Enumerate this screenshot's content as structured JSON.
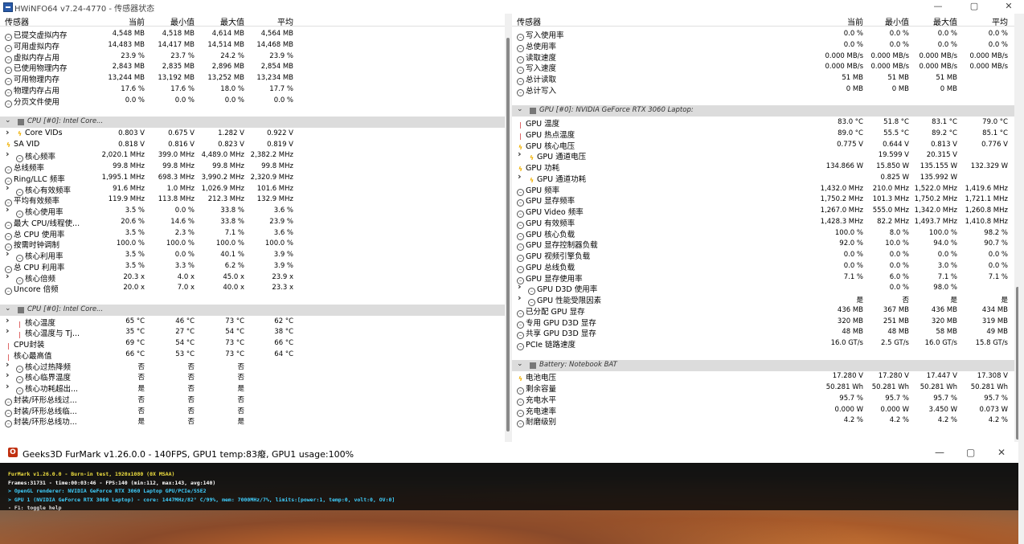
{
  "window": {
    "title": "HWiNFO64 v7.24-4770 - 传感器状态",
    "min": "—",
    "max": "▢",
    "close": "✕"
  },
  "left": {
    "headers": {
      "name": "传感器",
      "current": "当前",
      "min": "最小值",
      "max": "最大值",
      "avg": "平均"
    },
    "rows": [
      {
        "type": "item",
        "icon": "clock",
        "name": "已提交虚拟内存",
        "v": [
          "4,548 MB",
          "4,518 MB",
          "4,614 MB",
          "4,564 MB"
        ]
      },
      {
        "type": "item",
        "icon": "clock",
        "name": "可用虚拟内存",
        "v": [
          "14,483 MB",
          "14,417 MB",
          "14,514 MB",
          "14,468 MB"
        ]
      },
      {
        "type": "item",
        "icon": "clock",
        "name": "虚拟内存占用",
        "v": [
          "23.9 %",
          "23.7 %",
          "24.2 %",
          "23.9 %"
        ]
      },
      {
        "type": "item",
        "icon": "clock",
        "name": "已使用物理内存",
        "v": [
          "2,843 MB",
          "2,835 MB",
          "2,896 MB",
          "2,854 MB"
        ]
      },
      {
        "type": "item",
        "icon": "clock",
        "name": "可用物理内存",
        "v": [
          "13,244 MB",
          "13,192 MB",
          "13,252 MB",
          "13,234 MB"
        ]
      },
      {
        "type": "item",
        "icon": "clock",
        "name": "物理内存占用",
        "v": [
          "17.6 %",
          "17.6 %",
          "18.0 %",
          "17.7 %"
        ]
      },
      {
        "type": "item",
        "icon": "clock",
        "name": "分页文件使用",
        "v": [
          "0.0 %",
          "0.0 %",
          "0.0 %",
          "0.0 %"
        ]
      },
      {
        "type": "blank"
      },
      {
        "type": "group",
        "name": "CPU [#0]: Intel Core..."
      },
      {
        "type": "item",
        "expand": true,
        "icon": "bolt",
        "name": "Core VIDs",
        "v": [
          "0.803 V",
          "0.675 V",
          "1.282 V",
          "0.922 V"
        ]
      },
      {
        "type": "item",
        "icon": "bolt",
        "name": "SA VID",
        "v": [
          "0.818 V",
          "0.816 V",
          "0.823 V",
          "0.819 V"
        ]
      },
      {
        "type": "item",
        "expand": true,
        "icon": "clock",
        "name": "核心频率",
        "v": [
          "2,020.1 MHz",
          "399.0 MHz",
          "4,489.0 MHz",
          "2,382.2 MHz"
        ]
      },
      {
        "type": "item",
        "icon": "clock",
        "name": "总线频率",
        "v": [
          "99.8 MHz",
          "99.8 MHz",
          "99.8 MHz",
          "99.8 MHz"
        ]
      },
      {
        "type": "item",
        "icon": "clock",
        "name": "Ring/LLC 频率",
        "v": [
          "1,995.1 MHz",
          "698.3 MHz",
          "3,990.2 MHz",
          "2,320.9 MHz"
        ]
      },
      {
        "type": "item",
        "expand": true,
        "icon": "clock",
        "name": "核心有效频率",
        "v": [
          "91.6 MHz",
          "1.0 MHz",
          "1,026.9 MHz",
          "101.6 MHz"
        ]
      },
      {
        "type": "item",
        "icon": "clock",
        "name": "平均有效频率",
        "v": [
          "119.9 MHz",
          "113.8 MHz",
          "212.3 MHz",
          "132.9 MHz"
        ]
      },
      {
        "type": "item",
        "expand": true,
        "icon": "clock",
        "name": "核心使用率",
        "v": [
          "3.5 %",
          "0.0 %",
          "33.8 %",
          "3.6 %"
        ]
      },
      {
        "type": "item",
        "icon": "clock",
        "name": "最大 CPU/线程使...",
        "v": [
          "20.6 %",
          "14.6 %",
          "33.8 %",
          "23.9 %"
        ]
      },
      {
        "type": "item",
        "icon": "clock",
        "name": "总 CPU 使用率",
        "v": [
          "3.5 %",
          "2.3 %",
          "7.1 %",
          "3.6 %"
        ]
      },
      {
        "type": "item",
        "icon": "clock",
        "name": "按需时钟调制",
        "v": [
          "100.0 %",
          "100.0 %",
          "100.0 %",
          "100.0 %"
        ]
      },
      {
        "type": "item",
        "expand": true,
        "icon": "clock",
        "name": "核心利用率",
        "v": [
          "3.5 %",
          "0.0 %",
          "40.1 %",
          "3.9 %"
        ]
      },
      {
        "type": "item",
        "icon": "clock",
        "name": "总 CPU 利用率",
        "v": [
          "3.5 %",
          "3.3 %",
          "6.2 %",
          "3.9 %"
        ]
      },
      {
        "type": "item",
        "expand": true,
        "icon": "clock",
        "name": "核心倍频",
        "v": [
          "20.3 x",
          "4.0 x",
          "45.0 x",
          "23.9 x"
        ]
      },
      {
        "type": "item",
        "icon": "clock",
        "name": "Uncore 倍频",
        "v": [
          "20.0 x",
          "7.0 x",
          "40.0 x",
          "23.3 x"
        ]
      },
      {
        "type": "blank"
      },
      {
        "type": "group",
        "name": "CPU [#0]: Intel Core..."
      },
      {
        "type": "item",
        "expand": true,
        "icon": "therm",
        "name": "核心温度",
        "v": [
          "65 °C",
          "46 °C",
          "73 °C",
          "62 °C"
        ]
      },
      {
        "type": "item",
        "expand": true,
        "icon": "therm",
        "name": "核心温度与 Tj...",
        "v": [
          "35 °C",
          "27 °C",
          "54 °C",
          "38 °C"
        ]
      },
      {
        "type": "item",
        "icon": "therm",
        "name": "CPU封装",
        "v": [
          "69 °C",
          "54 °C",
          "73 °C",
          "66 °C"
        ]
      },
      {
        "type": "item",
        "icon": "therm",
        "name": "核心最高值",
        "v": [
          "66 °C",
          "53 °C",
          "73 °C",
          "64 °C"
        ]
      },
      {
        "type": "item",
        "expand": true,
        "icon": "clock",
        "name": "核心过热降频",
        "v": [
          "否",
          "否",
          "否",
          ""
        ]
      },
      {
        "type": "item",
        "expand": true,
        "icon": "clock",
        "name": "核心临界温度",
        "v": [
          "否",
          "否",
          "否",
          ""
        ]
      },
      {
        "type": "item",
        "expand": true,
        "icon": "clock",
        "name": "核心功耗超出...",
        "v": [
          "是",
          "否",
          "是",
          ""
        ]
      },
      {
        "type": "item",
        "icon": "clock",
        "name": "封装/环形总线过...",
        "v": [
          "否",
          "否",
          "否",
          ""
        ]
      },
      {
        "type": "item",
        "icon": "clock",
        "name": "封装/环形总线临...",
        "v": [
          "否",
          "否",
          "否",
          ""
        ]
      },
      {
        "type": "item",
        "icon": "clock",
        "name": "封装/环形总线功...",
        "v": [
          "是",
          "否",
          "是",
          ""
        ]
      }
    ]
  },
  "right": {
    "headers": {
      "name": "传感器",
      "current": "当前",
      "min": "最小值",
      "max": "最大值",
      "avg": "平均"
    },
    "rows": [
      {
        "type": "item",
        "icon": "clock",
        "name": "写入使用率",
        "v": [
          "0.0 %",
          "0.0 %",
          "0.0 %",
          "0.0 %"
        ]
      },
      {
        "type": "item",
        "icon": "clock",
        "name": "总使用率",
        "v": [
          "0.0 %",
          "0.0 %",
          "0.0 %",
          "0.0 %"
        ]
      },
      {
        "type": "item",
        "icon": "clock",
        "name": "读取速度",
        "v": [
          "0.000 MB/s",
          "0.000 MB/s",
          "0.000 MB/s",
          "0.000 MB/s"
        ]
      },
      {
        "type": "item",
        "icon": "clock",
        "name": "写入速度",
        "v": [
          "0.000 MB/s",
          "0.000 MB/s",
          "0.000 MB/s",
          "0.000 MB/s"
        ]
      },
      {
        "type": "item",
        "icon": "clock",
        "name": "总计读取",
        "v": [
          "51 MB",
          "51 MB",
          "51 MB",
          ""
        ]
      },
      {
        "type": "item",
        "icon": "clock",
        "name": "总计写入",
        "v": [
          "0 MB",
          "0 MB",
          "0 MB",
          ""
        ]
      },
      {
        "type": "blank"
      },
      {
        "type": "group",
        "name": "GPU [#0]: NVIDIA GeForce RTX 3060 Laptop:"
      },
      {
        "type": "item",
        "icon": "therm",
        "name": "GPU 温度",
        "v": [
          "83.0 °C",
          "51.8 °C",
          "83.1 °C",
          "79.0 °C"
        ]
      },
      {
        "type": "item",
        "icon": "therm",
        "name": "GPU 热点温度",
        "v": [
          "89.0 °C",
          "55.5 °C",
          "89.2 °C",
          "85.1 °C"
        ]
      },
      {
        "type": "item",
        "icon": "bolt",
        "name": "GPU 核心电压",
        "v": [
          "0.775 V",
          "0.644 V",
          "0.813 V",
          "0.776 V"
        ]
      },
      {
        "type": "item",
        "expand": true,
        "icon": "bolt",
        "name": "GPU 通道电压",
        "v": [
          "",
          "19.599 V",
          "20.315 V",
          ""
        ]
      },
      {
        "type": "item",
        "icon": "bolt",
        "name": "GPU 功耗",
        "v": [
          "134.866 W",
          "15.850 W",
          "135.155 W",
          "132.329 W"
        ]
      },
      {
        "type": "item",
        "expand": true,
        "icon": "bolt",
        "name": "GPU 通道功耗",
        "v": [
          "",
          "0.825 W",
          "135.992 W",
          ""
        ]
      },
      {
        "type": "item",
        "icon": "clock",
        "name": "GPU 频率",
        "v": [
          "1,432.0 MHz",
          "210.0 MHz",
          "1,522.0 MHz",
          "1,419.6 MHz"
        ]
      },
      {
        "type": "item",
        "icon": "clock",
        "name": "GPU 显存频率",
        "v": [
          "1,750.2 MHz",
          "101.3 MHz",
          "1,750.2 MHz",
          "1,721.1 MHz"
        ]
      },
      {
        "type": "item",
        "icon": "clock",
        "name": "GPU Video 频率",
        "v": [
          "1,267.0 MHz",
          "555.0 MHz",
          "1,342.0 MHz",
          "1,260.8 MHz"
        ]
      },
      {
        "type": "item",
        "icon": "clock",
        "name": "GPU 有效频率",
        "v": [
          "1,428.3 MHz",
          "82.2 MHz",
          "1,493.7 MHz",
          "1,410.8 MHz"
        ]
      },
      {
        "type": "item",
        "icon": "clock",
        "name": "GPU 核心负载",
        "v": [
          "100.0 %",
          "8.0 %",
          "100.0 %",
          "98.2 %"
        ]
      },
      {
        "type": "item",
        "icon": "clock",
        "name": "GPU 显存控制器负载",
        "v": [
          "92.0 %",
          "10.0 %",
          "94.0 %",
          "90.7 %"
        ]
      },
      {
        "type": "item",
        "icon": "clock",
        "name": "GPU 视频引擎负载",
        "v": [
          "0.0 %",
          "0.0 %",
          "0.0 %",
          "0.0 %"
        ]
      },
      {
        "type": "item",
        "icon": "clock",
        "name": "GPU 总线负载",
        "v": [
          "0.0 %",
          "0.0 %",
          "3.0 %",
          "0.0 %"
        ]
      },
      {
        "type": "item",
        "icon": "clock",
        "name": "GPU 显存使用率",
        "v": [
          "7.1 %",
          "6.0 %",
          "7.1 %",
          "7.1 %"
        ]
      },
      {
        "type": "item",
        "expand": true,
        "icon": "clock",
        "name": "GPU D3D 使用率",
        "v": [
          "",
          "0.0 %",
          "98.0 %",
          ""
        ]
      },
      {
        "type": "item",
        "expand": true,
        "icon": "clock",
        "name": "GPU 性能受限因素",
        "v": [
          "是",
          "否",
          "是",
          "是"
        ]
      },
      {
        "type": "item",
        "icon": "clock",
        "name": "已分配 GPU 显存",
        "v": [
          "436 MB",
          "367 MB",
          "436 MB",
          "434 MB"
        ]
      },
      {
        "type": "item",
        "icon": "clock",
        "name": "专用 GPU D3D 显存",
        "v": [
          "320 MB",
          "251 MB",
          "320 MB",
          "319 MB"
        ]
      },
      {
        "type": "item",
        "icon": "clock",
        "name": "共享 GPU D3D 显存",
        "v": [
          "48 MB",
          "48 MB",
          "58 MB",
          "49 MB"
        ]
      },
      {
        "type": "item",
        "icon": "clock",
        "name": "PCIe 链路速度",
        "v": [
          "16.0 GT/s",
          "2.5 GT/s",
          "16.0 GT/s",
          "15.8 GT/s"
        ]
      },
      {
        "type": "blank"
      },
      {
        "type": "group",
        "name": "Battery: Notebook BAT"
      },
      {
        "type": "item",
        "icon": "bolt",
        "name": "电池电压",
        "v": [
          "17.280 V",
          "17.280 V",
          "17.447 V",
          "17.308 V"
        ]
      },
      {
        "type": "item",
        "icon": "clock",
        "name": "剩余容量",
        "v": [
          "50.281 Wh",
          "50.281 Wh",
          "50.281 Wh",
          "50.281 Wh"
        ]
      },
      {
        "type": "item",
        "icon": "clock",
        "name": "充电水平",
        "v": [
          "95.7 %",
          "95.7 %",
          "95.7 %",
          "95.7 %"
        ]
      },
      {
        "type": "item",
        "icon": "clock",
        "name": "充电速率",
        "v": [
          "0.000 W",
          "0.000 W",
          "3.450 W",
          "0.073 W"
        ]
      },
      {
        "type": "item",
        "icon": "clock",
        "name": "耐磨级别",
        "v": [
          "4.2 %",
          "4.2 %",
          "4.2 %",
          "4.2 %"
        ]
      }
    ]
  },
  "furmark": {
    "title": "Geeks3D FurMark v1.26.0.0 - 140FPS, GPU1 temp:83癈, GPU1 usage:100%",
    "min": "—",
    "max": "▢",
    "close": "✕",
    "lines": [
      {
        "text": "FurMark v1.26.0.0 - Burn-in test, 1920x1080 (0X MSAA)",
        "color": "#f0e040"
      },
      {
        "text": "Frames:31731 - time:00:03:46 - FPS:140 (min:112, max:143, avg:140)",
        "color": "#ffffff"
      },
      {
        "text": "> OpenGL renderer: NVIDIA GeForce RTX 3060 Laptop GPU/PCIe/SSE2",
        "color": "#40d0ff"
      },
      {
        "text": "> GPU 1 (NVIDIA GeForce RTX 3060 Laptop) - core: 1447MHz/82° C/99%, mem: 7000MHz/7%, limits:[power:1, temp:0, volt:0, OV:0]",
        "color": "#40d0ff"
      },
      {
        "text": "- F1: toggle help",
        "color": "#dddddd"
      }
    ]
  }
}
